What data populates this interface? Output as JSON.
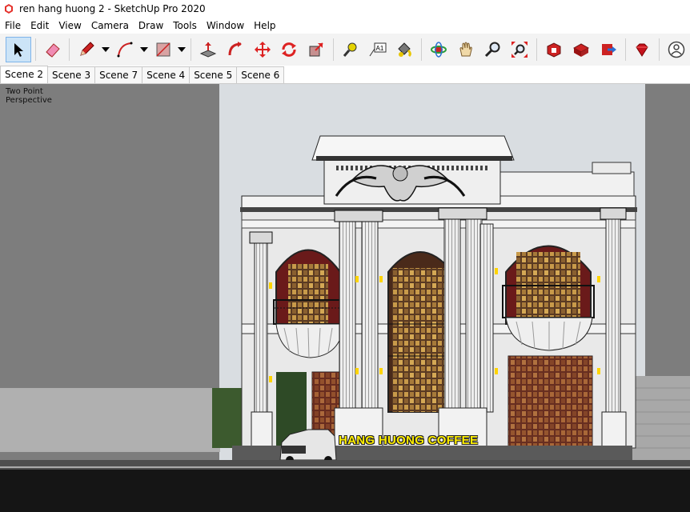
{
  "window": {
    "title": "ren hang huong 2 - SketchUp Pro 2020"
  },
  "menu": [
    "File",
    "Edit",
    "View",
    "Camera",
    "Draw",
    "Tools",
    "Window",
    "Help"
  ],
  "toolbar": {
    "tools": [
      {
        "name": "select-tool-button",
        "icon": "arrow-cursor-icon"
      },
      {
        "name": "eraser-tool-button",
        "icon": "eraser-icon"
      },
      {
        "name": "line-tool-button",
        "icon": "pencil-icon"
      },
      {
        "name": "arc-tool-button",
        "icon": "arc-icon"
      },
      {
        "name": "rectangle-tool-button",
        "icon": "rectangle-icon"
      },
      {
        "name": "push-pull-tool-button",
        "icon": "push-pull-icon"
      },
      {
        "name": "follow-me-tool-button",
        "icon": "follow-me-icon"
      },
      {
        "name": "move-tool-button",
        "icon": "move-icon"
      },
      {
        "name": "rotate-tool-button",
        "icon": "rotate-icon"
      },
      {
        "name": "scale-tool-button",
        "icon": "scale-icon"
      },
      {
        "name": "tape-measure-tool-button",
        "icon": "tape-measure-icon"
      },
      {
        "name": "text-tool-button",
        "icon": "text-icon",
        "label": "A1"
      },
      {
        "name": "paint-bucket-tool-button",
        "icon": "paint-bucket-icon"
      },
      {
        "name": "orbit-tool-button",
        "icon": "orbit-icon"
      },
      {
        "name": "pan-tool-button",
        "icon": "hand-icon"
      },
      {
        "name": "zoom-tool-button",
        "icon": "magnifier-icon"
      },
      {
        "name": "zoom-extents-button",
        "icon": "zoom-extents-icon"
      },
      {
        "name": "3d-warehouse-button",
        "icon": "warehouse-icon"
      },
      {
        "name": "extension-warehouse-button",
        "icon": "extension-warehouse-icon"
      },
      {
        "name": "share-model-button",
        "icon": "share-icon"
      },
      {
        "name": "extension-manager-button",
        "icon": "ruby-icon"
      },
      {
        "name": "account-button",
        "icon": "user-icon"
      }
    ]
  },
  "scenes": {
    "tabs": [
      "Scene 2",
      "Scene 3",
      "Scene 7",
      "Scene 4",
      "Scene 5",
      "Scene 6"
    ],
    "active": 0
  },
  "viewport": {
    "camera_line1": "Two Point",
    "camera_line2": "Perspective",
    "sign_text": "HANG HUONG COFFEE"
  },
  "colors": {
    "sky": "#d9dde1",
    "ground": "#7d7d7d",
    "sign": "#ffee00",
    "facade": "#e9e9e9",
    "curtain": "#7a1d1d"
  }
}
